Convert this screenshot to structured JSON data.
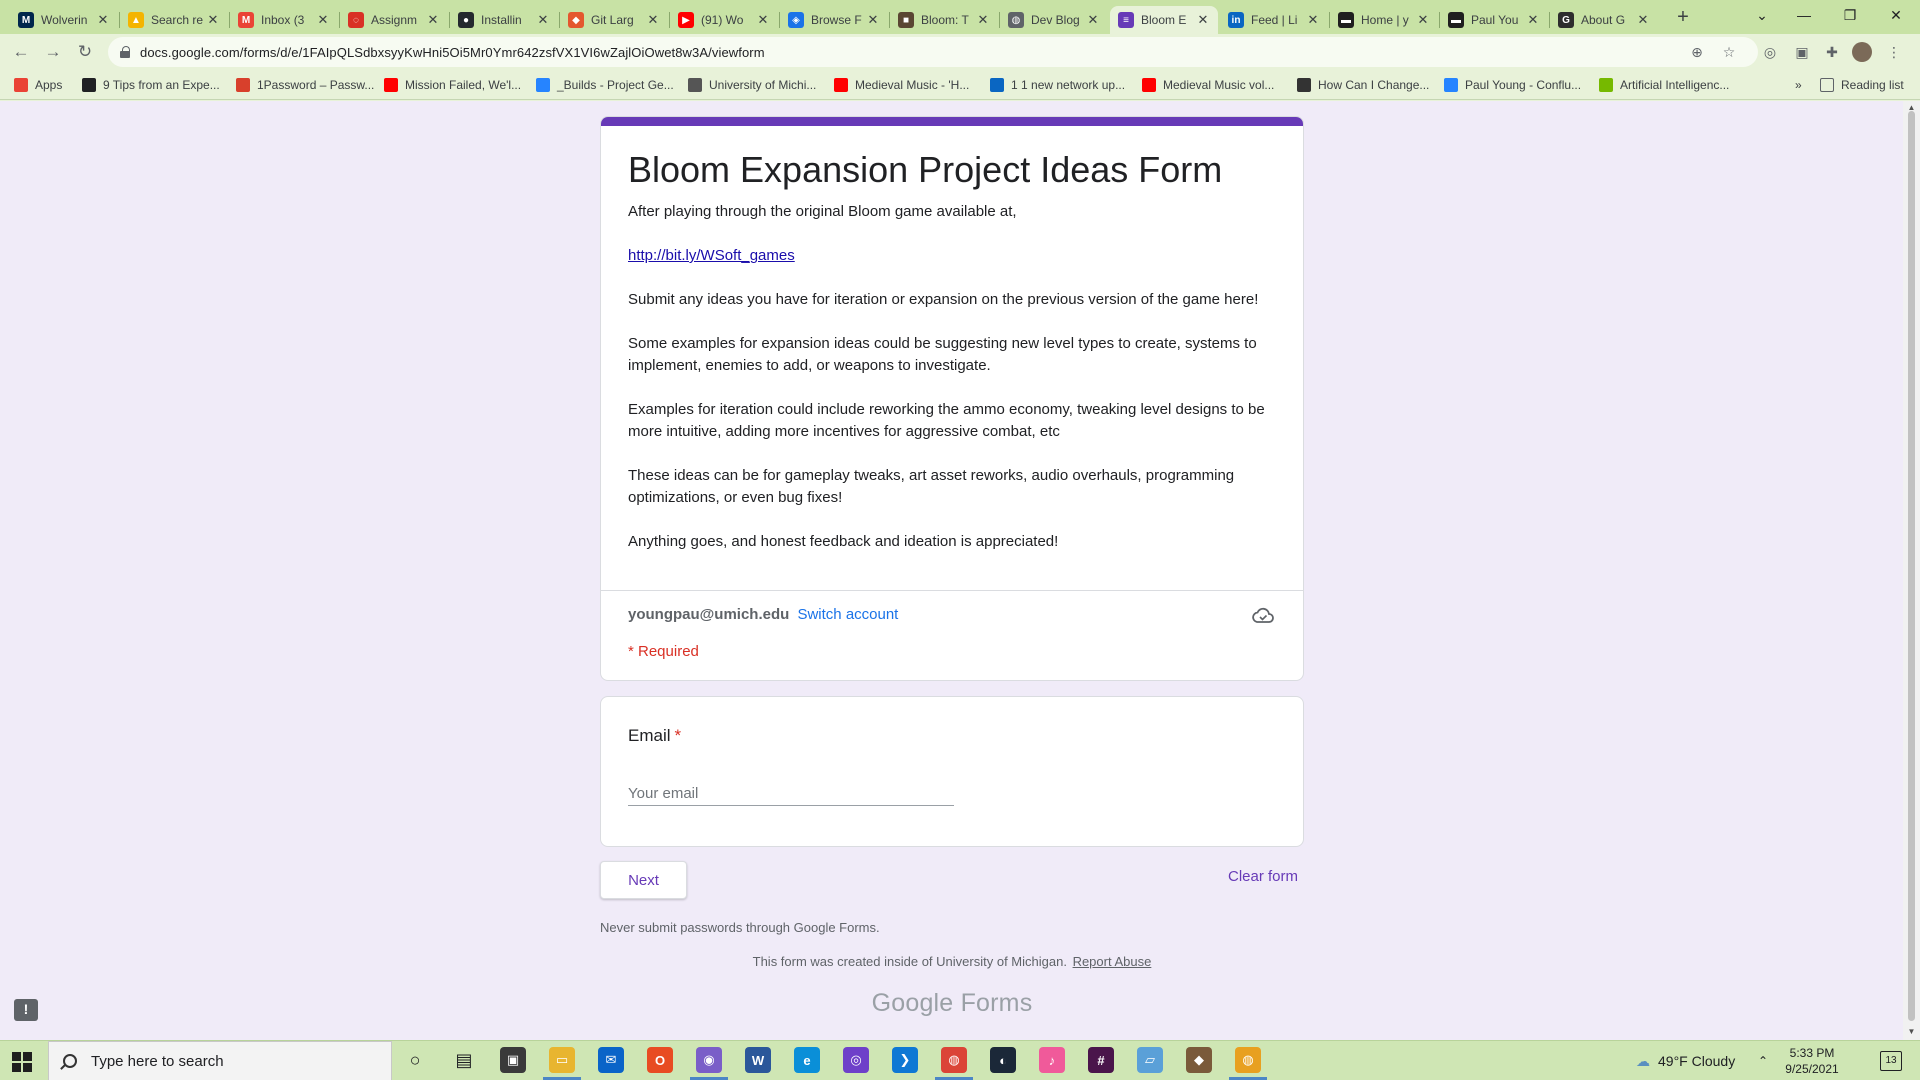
{
  "browser": {
    "tabs": [
      {
        "title": "Wolverin",
        "color": "#00274c",
        "glyph": "M"
      },
      {
        "title": "Search re",
        "color": "#f4b400",
        "glyph": "▲"
      },
      {
        "title": "Inbox (3",
        "color": "#ea4335",
        "glyph": "M"
      },
      {
        "title": "Assignm",
        "color": "#d93025",
        "glyph": "◌"
      },
      {
        "title": "Installin",
        "color": "#24292e",
        "glyph": "●"
      },
      {
        "title": "Git Larg",
        "color": "#e4572e",
        "glyph": "◆"
      },
      {
        "title": "(91) Wo",
        "color": "#ff0000",
        "glyph": "▶"
      },
      {
        "title": "Browse F",
        "color": "#1a73e8",
        "glyph": "◈"
      },
      {
        "title": "Bloom: T",
        "color": "#5a4632",
        "glyph": "■"
      },
      {
        "title": "Dev Blog",
        "color": "#5f6368",
        "glyph": "◍"
      },
      {
        "title": "Bloom E",
        "color": "#673ab7",
        "glyph": "≡"
      },
      {
        "title": "Feed | Li",
        "color": "#0a66c2",
        "glyph": "in"
      },
      {
        "title": "Home | y",
        "color": "#1f1f1f",
        "glyph": "▬"
      },
      {
        "title": "Paul You",
        "color": "#1f1f1f",
        "glyph": "▬"
      },
      {
        "title": "About G",
        "color": "#2d2d2d",
        "glyph": "G"
      }
    ],
    "url": "docs.google.com/forms/d/e/1FAIpQLSdbxsyyKwHni5Oi5Mr0Ymr642zsfVX1VI6wZajlOiOwet8w3A/viewform",
    "bookmarks": [
      {
        "label": "Apps",
        "color": "#ea4335"
      },
      {
        "label": "9 Tips from an Expe...",
        "color": "#202124"
      },
      {
        "label": "1Password – Passw...",
        "color": "#d8402c"
      },
      {
        "label": "Mission Failed, We'l...",
        "color": "#ff0000"
      },
      {
        "label": "_Builds - Project Ge...",
        "color": "#2684ff"
      },
      {
        "label": "University of Michi...",
        "color": "#555555"
      },
      {
        "label": "Medieval Music - 'H...",
        "color": "#ff0000"
      },
      {
        "label": "1 1 new network up...",
        "color": "#0a66c2"
      },
      {
        "label": "Medieval Music vol...",
        "color": "#ff0000"
      },
      {
        "label": "How Can I Change...",
        "color": "#333333"
      },
      {
        "label": "Paul Young - Conflu...",
        "color": "#2684ff"
      },
      {
        "label": "Artificial Intelligenc...",
        "color": "#76b900"
      }
    ],
    "reading_list": "Reading list"
  },
  "form": {
    "title": "Bloom Expansion Project Ideas Form",
    "desc_1": "After playing through the original Bloom game available at,",
    "link": "http://bit.ly/WSoft_games",
    "desc_2": "Submit any ideas you have for iteration or expansion on the previous version of the game here!",
    "desc_3": "Some examples for expansion ideas could be suggesting new level types to create, systems to implement, enemies to add, or weapons to investigate.",
    "desc_4": "Examples for iteration could include reworking the ammo economy, tweaking level designs to be more intuitive, adding more incentives for aggressive combat, etc",
    "desc_5": "These ideas can be for gameplay tweaks, art asset reworks, audio overhauls, programming optimizations, or even bug fixes!",
    "desc_6": "Anything goes, and honest feedback and ideation is appreciated!",
    "account_email": "youngpau@umich.edu",
    "switch_account": "Switch account",
    "required_note": "* Required",
    "question_label": "Email",
    "question_star": "*",
    "email_placeholder": "Your email",
    "next_label": "Next",
    "clear_label": "Clear form",
    "never_submit": "Never submit passwords through Google Forms.",
    "created_text": "This form was created inside of University of Michigan.",
    "report_abuse": "Report Abuse",
    "brand_google": "Google",
    "brand_forms": "Forms",
    "accent": "#673ab7",
    "page_bg": "#f0ebf8"
  },
  "taskbar": {
    "search_text": "Type here to search",
    "apps": [
      {
        "name": "cortana-icon",
        "color": "#cfe6b4",
        "glyph": "○"
      },
      {
        "name": "task-view-icon",
        "color": "#cfe6b4",
        "glyph": "▤"
      },
      {
        "name": "store-icon",
        "color": "#3a3a3a",
        "glyph": "▣"
      },
      {
        "name": "file-explorer-icon",
        "color": "#e8b530",
        "glyph": "▭"
      },
      {
        "name": "mail-icon",
        "color": "#0a64c8",
        "glyph": "✉"
      },
      {
        "name": "office-icon",
        "color": "#e84c22",
        "glyph": "O"
      },
      {
        "name": "discord-icon",
        "color": "#7a5ec8",
        "glyph": "◉"
      },
      {
        "name": "word-icon",
        "color": "#2b579a",
        "glyph": "W"
      },
      {
        "name": "edge-icon",
        "color": "#0a8fd8",
        "glyph": "e"
      },
      {
        "name": "github-desktop-icon",
        "color": "#6e40c9",
        "glyph": "◎"
      },
      {
        "name": "vscode-icon",
        "color": "#0e78d4",
        "glyph": "❯"
      },
      {
        "name": "chrome-icon",
        "color": "#db4437",
        "glyph": "◍"
      },
      {
        "name": "steam-icon",
        "color": "#1b2838",
        "glyph": "◐"
      },
      {
        "name": "itunes-icon",
        "color": "#f05a9a",
        "glyph": "♪"
      },
      {
        "name": "slack-icon",
        "color": "#4a154b",
        "glyph": "#"
      },
      {
        "name": "notepad-icon",
        "color": "#5aa0d8",
        "glyph": "▱"
      },
      {
        "name": "minecraft-icon",
        "color": "#7a5a3a",
        "glyph": "◆"
      },
      {
        "name": "chrome-canary-icon",
        "color": "#e8a020",
        "glyph": "◍"
      }
    ],
    "weather": "49°F  Cloudy",
    "time": "5:33 PM",
    "date": "9/25/2021",
    "notification_count": "13"
  }
}
